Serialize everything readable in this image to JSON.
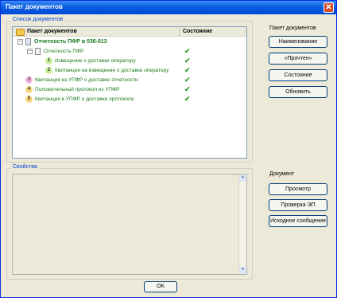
{
  "window": {
    "title": "Пакет документов",
    "close_glyph": "✕"
  },
  "documents_group": {
    "label": "Список документов",
    "tree_header": {
      "col_name": "Пакет документов",
      "col_status": "Состояние"
    },
    "rows": [
      {
        "label": "Отчетность ПФР в 036-013",
        "bold": true,
        "badge": "",
        "status": "",
        "badge_color": ""
      },
      {
        "label": "Отчетность ПФР",
        "bold": false,
        "badge": "",
        "status": "✔",
        "badge_color": ""
      },
      {
        "label": "Извещение о доставке оператору",
        "bold": false,
        "badge": "1",
        "status": "✔",
        "badge_color": "#c9ef9c"
      },
      {
        "label": "Квитанция на извещение о доставке оператору",
        "bold": false,
        "badge": "2",
        "status": "✔",
        "badge_color": "#c9ef9c"
      },
      {
        "label": "Квитанция из УПФР о доставке отчетности",
        "bold": false,
        "badge": "3",
        "status": "✔",
        "badge_color": "#f3b6dc"
      },
      {
        "label": "Положительный протокол из УПФР",
        "bold": false,
        "badge": "4",
        "status": "✔",
        "badge_color": "#f8d87b"
      },
      {
        "label": "Квитанция в УПФР о доставке протокола",
        "bold": false,
        "badge": "5",
        "status": "✔",
        "badge_color": "#f8d87b"
      }
    ]
  },
  "package_panel": {
    "label": "Пакет документов",
    "buttons": [
      "Наименование",
      "«Прочтен»",
      "Состояние",
      "Обновить"
    ]
  },
  "properties_group": {
    "label": "Свойства"
  },
  "document_panel": {
    "label": "Документ",
    "buttons": [
      "Просмотр",
      "Проверка ЭП",
      "Исходное сообщение"
    ]
  },
  "footer": {
    "ok_label": "OK"
  }
}
